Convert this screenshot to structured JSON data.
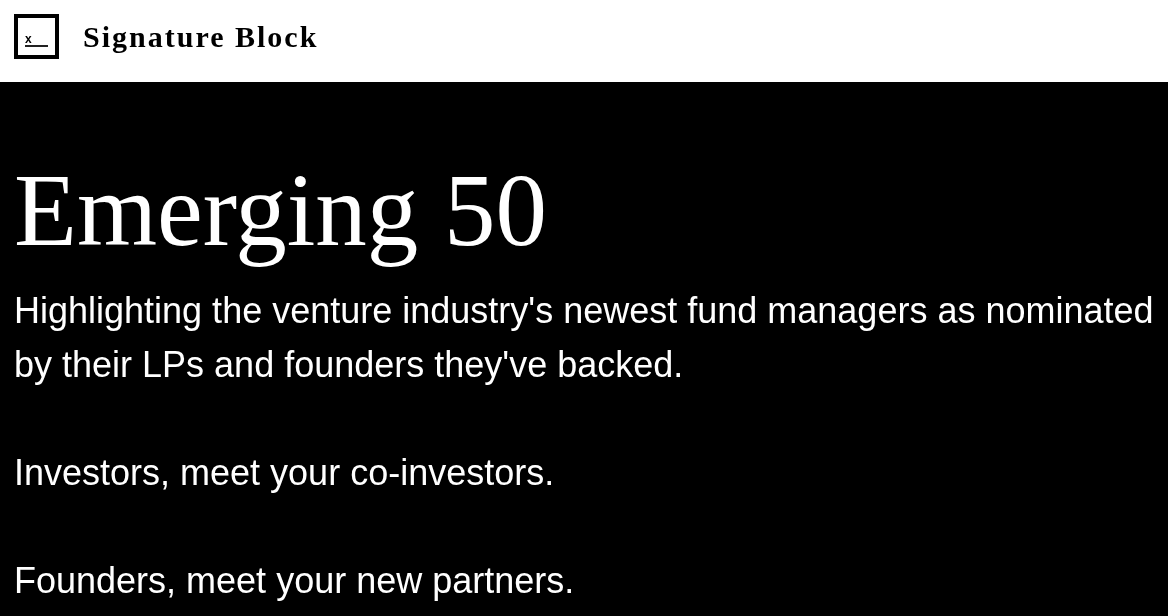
{
  "header": {
    "logo_mark": "x",
    "brand": "Signature Block"
  },
  "hero": {
    "title": "Emerging 50",
    "paragraphs": [
      "Highlighting the venture industry's newest fund managers as nominated by their LPs and founders they've backed.",
      "Investors, meet your co-investors.",
      "Founders, meet your new partners."
    ]
  }
}
